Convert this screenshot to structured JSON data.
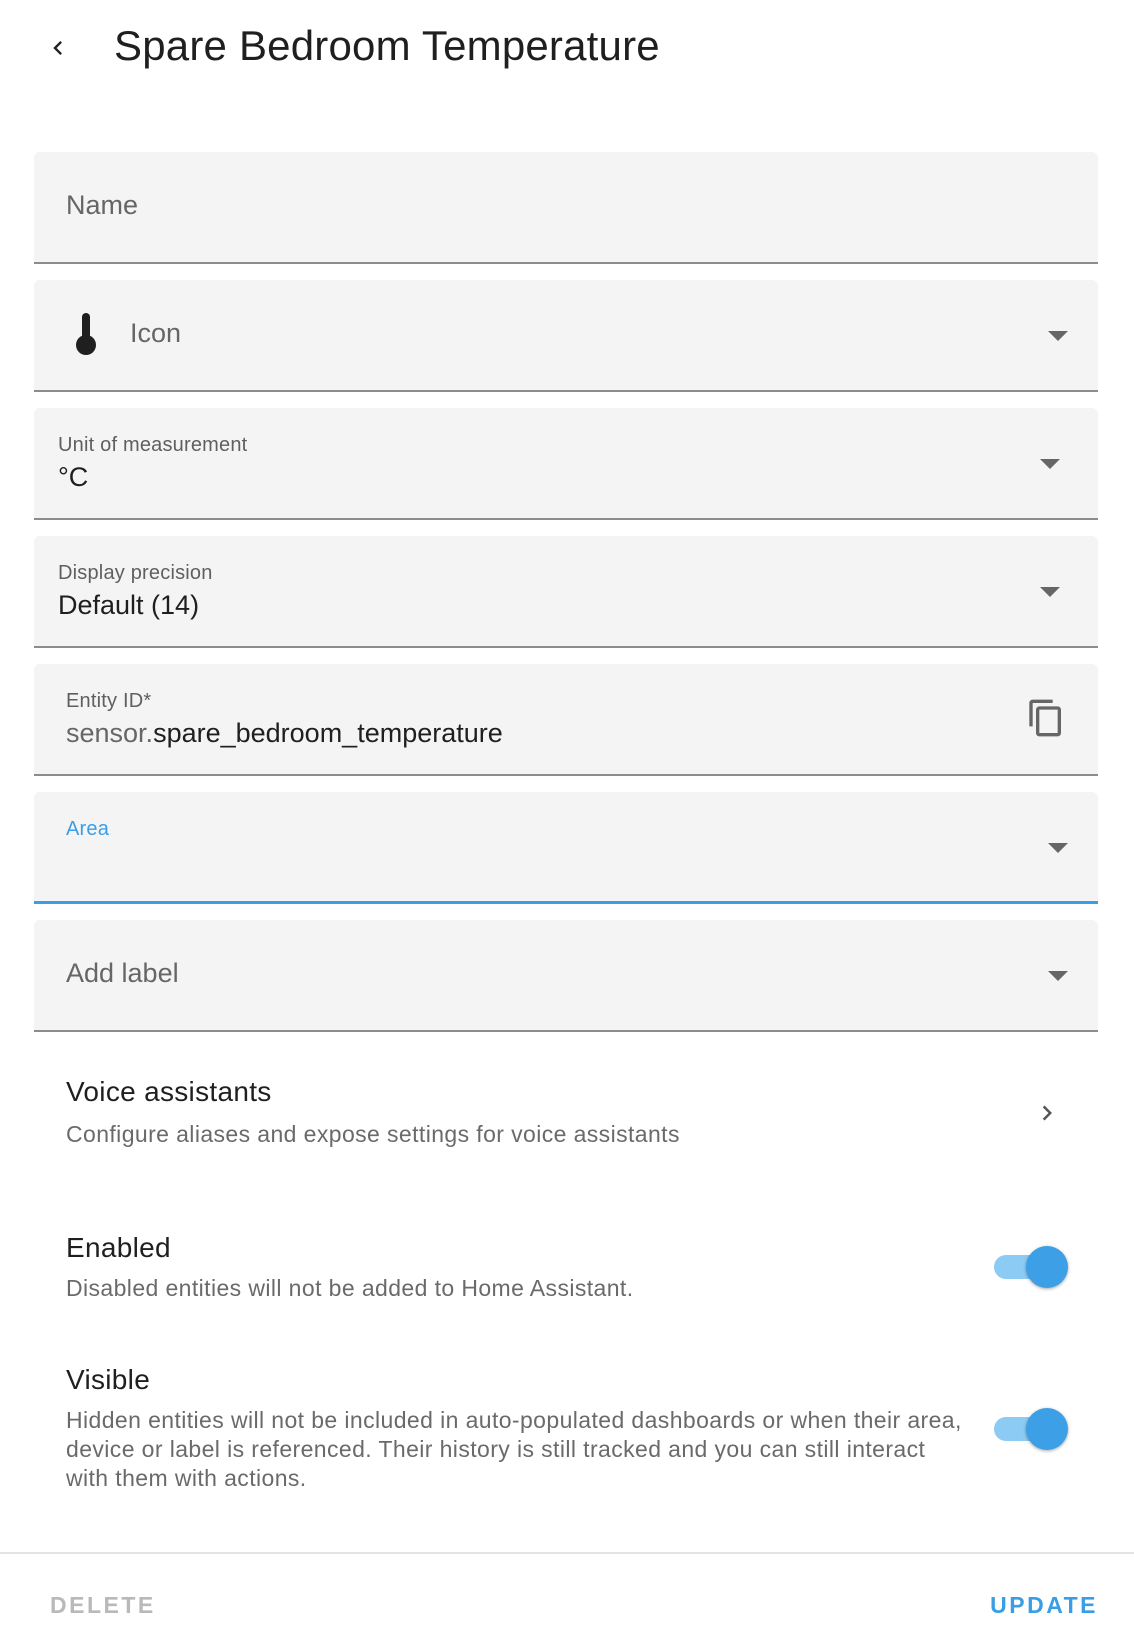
{
  "header": {
    "title": "Spare Bedroom Temperature"
  },
  "fields": {
    "name": {
      "placeholder": "Name"
    },
    "icon": {
      "placeholder": "Icon",
      "icon": "thermometer-icon"
    },
    "unit": {
      "label": "Unit of measurement",
      "value": "°C"
    },
    "precision": {
      "label": "Display precision",
      "value": "Default (14)"
    },
    "entity_id": {
      "label": "Entity ID*",
      "prefix": "sensor.",
      "value": "spare_bedroom_temperature"
    },
    "area": {
      "label": "Area",
      "value": ""
    },
    "labels": {
      "placeholder": "Add label"
    }
  },
  "voice": {
    "title": "Voice assistants",
    "description": "Configure aliases and expose settings for voice assistants"
  },
  "enabled": {
    "title": "Enabled",
    "description": "Disabled entities will not be added to Home Assistant.",
    "on": true
  },
  "visible": {
    "title": "Visible",
    "description": "Hidden entities will not be included in auto-populated dashboards or when their area, device or label is referenced. Their history is still tracked and you can still interact with them with actions.",
    "on": true
  },
  "footer": {
    "delete_label": "DELETE",
    "update_label": "UPDATE"
  },
  "colors": {
    "accent": "#3a9ee6",
    "field_bg": "#f4f4f4"
  }
}
